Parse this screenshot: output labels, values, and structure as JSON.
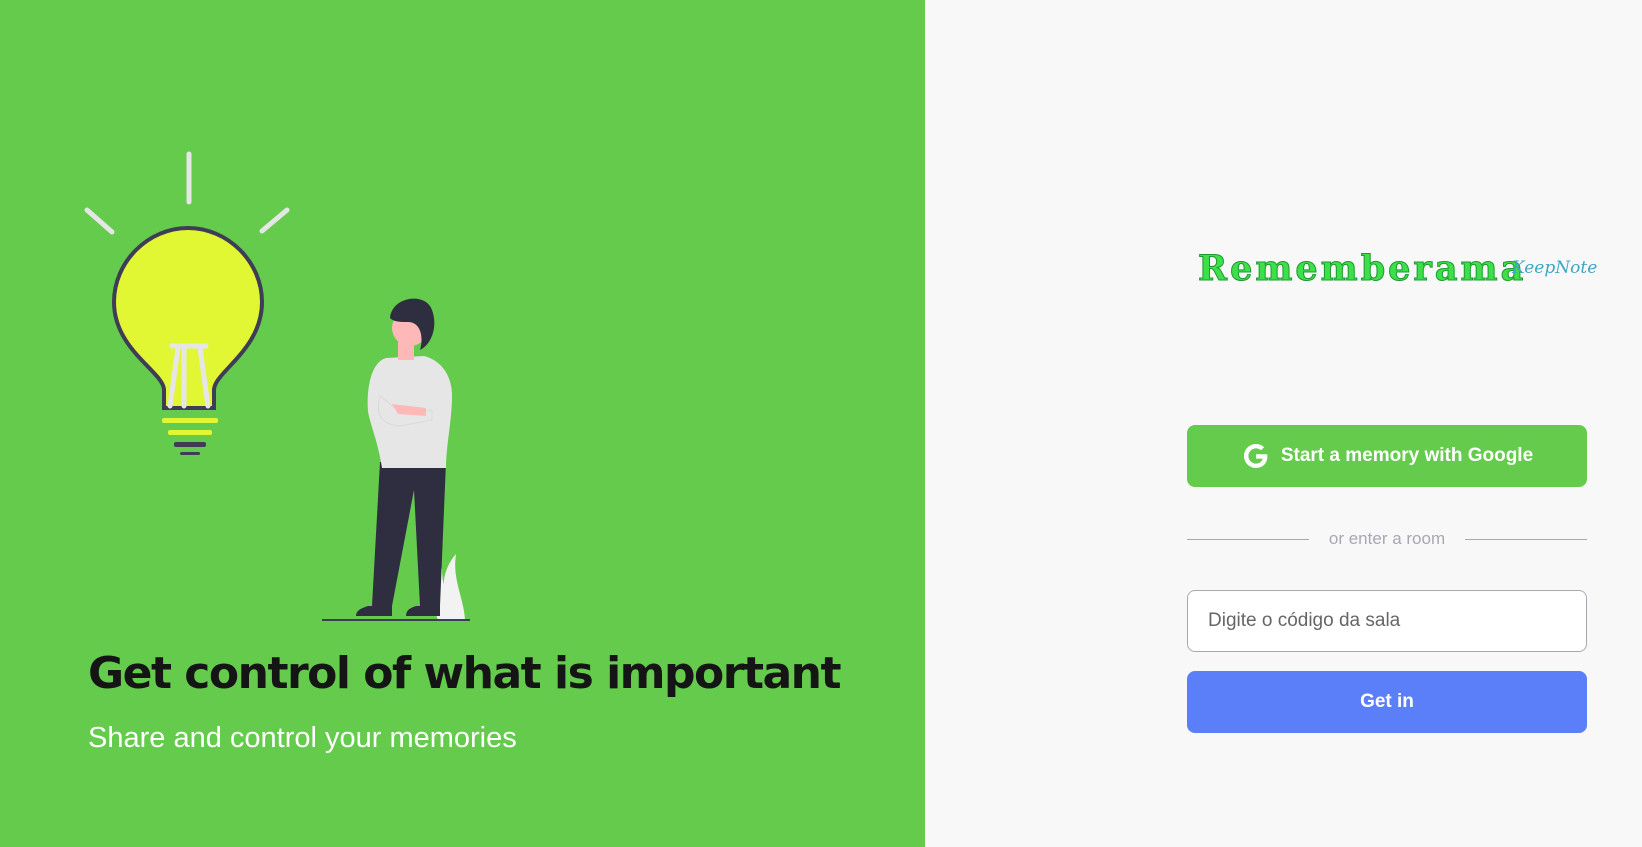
{
  "hero": {
    "headline": "Get control of what is important",
    "subline": "Share and control your memories"
  },
  "brand": {
    "name": "Rememberama",
    "tagline": "KeepNote"
  },
  "auth": {
    "google_button_label": "Start a memory with Google",
    "google_icon": "google-g-icon",
    "separator_text": "or enter a room",
    "room_input_placeholder": "Digite o código da sala",
    "room_input_value": "",
    "submit_label": "Get in"
  },
  "colors": {
    "left_panel_bg": "#64cb4c",
    "right_panel_bg": "#f8f8f8",
    "google_button_bg": "#64cb4c",
    "submit_button_bg": "#5b7ff9",
    "logo_green": "#3ee04a",
    "tagline_blue": "#3ea6c4",
    "bulb_yellow": "#e2f734"
  }
}
